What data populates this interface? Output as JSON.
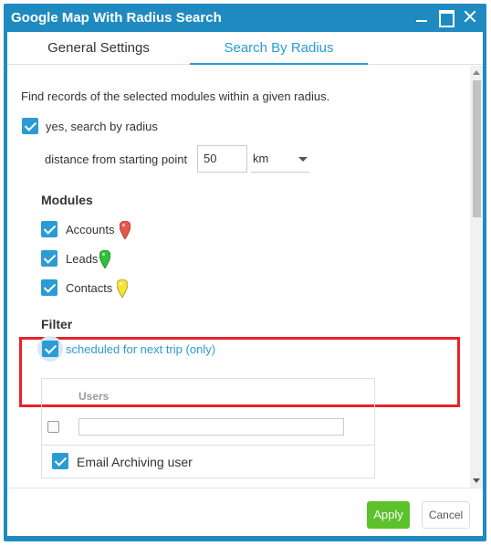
{
  "window": {
    "title": "Google Map With Radius Search"
  },
  "tabs": [
    {
      "label": "General Settings",
      "active": false
    },
    {
      "label": "Search By Radius",
      "active": true
    }
  ],
  "search": {
    "description": "Find records of the selected modules within a given radius.",
    "enable_label": "yes, search by radius",
    "enable_checked": true,
    "distance_label": "distance from starting point",
    "distance_value": "50",
    "unit_value": "km"
  },
  "modules": {
    "heading": "Modules",
    "items": [
      {
        "label": "Accounts",
        "checked": true,
        "pin_color": "#e8584a"
      },
      {
        "label": "Leads",
        "checked": true,
        "pin_color": "#2dc23a"
      },
      {
        "label": "Contacts",
        "checked": true,
        "pin_color": "#f5e23a"
      }
    ]
  },
  "filter": {
    "heading": "Filter",
    "option_label": "scheduled for next trip (only)",
    "option_checked": true,
    "highlight_color": "#e8222a"
  },
  "users": {
    "heading": "Users",
    "search_value": "",
    "rows": [
      {
        "name": "Email Archiving user",
        "checked": true
      }
    ]
  },
  "footer": {
    "apply_label": "Apply",
    "cancel_label": "Cancel"
  },
  "colors": {
    "titlebar": "#1f8ac0",
    "accent": "#2b9bd3",
    "apply": "#5cc12a"
  }
}
